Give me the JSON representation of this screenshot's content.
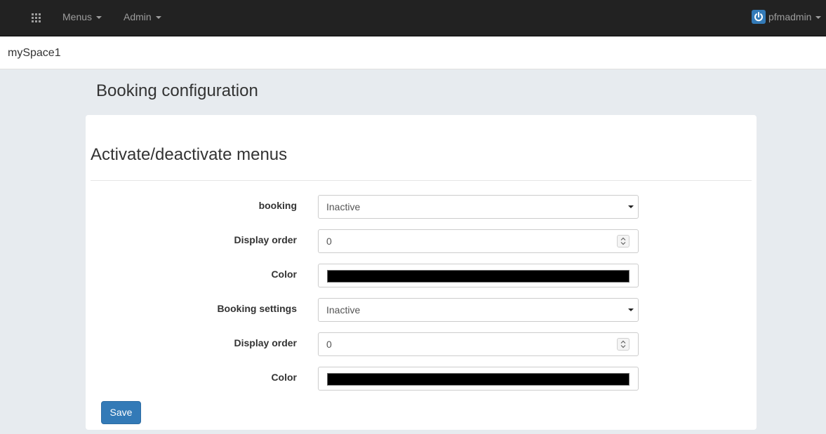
{
  "navbar": {
    "grid_icon": "grid-icon",
    "menus_label": "Menus",
    "admin_label": "Admin",
    "user_icon": "power-icon",
    "user_label": "pfmadmin"
  },
  "space": {
    "name": "mySpace1"
  },
  "page": {
    "title": "Booking configuration"
  },
  "panel": {
    "heading": "Activate/deactivate menus",
    "fields": [
      {
        "label": "booking",
        "type": "select",
        "value": "Inactive"
      },
      {
        "label": "Display order",
        "type": "number",
        "value": "0"
      },
      {
        "label": "Color",
        "type": "color",
        "value": "#000000"
      },
      {
        "label": "Booking settings",
        "type": "select",
        "value": "Inactive"
      },
      {
        "label": "Display order",
        "type": "number",
        "value": "0"
      },
      {
        "label": "Color",
        "type": "color",
        "value": "#000000"
      }
    ],
    "save_label": "Save"
  },
  "colors": {
    "navbar_bg": "#222222",
    "page_bg": "#e7ebef",
    "primary": "#337ab7",
    "swatch": "#000000"
  }
}
